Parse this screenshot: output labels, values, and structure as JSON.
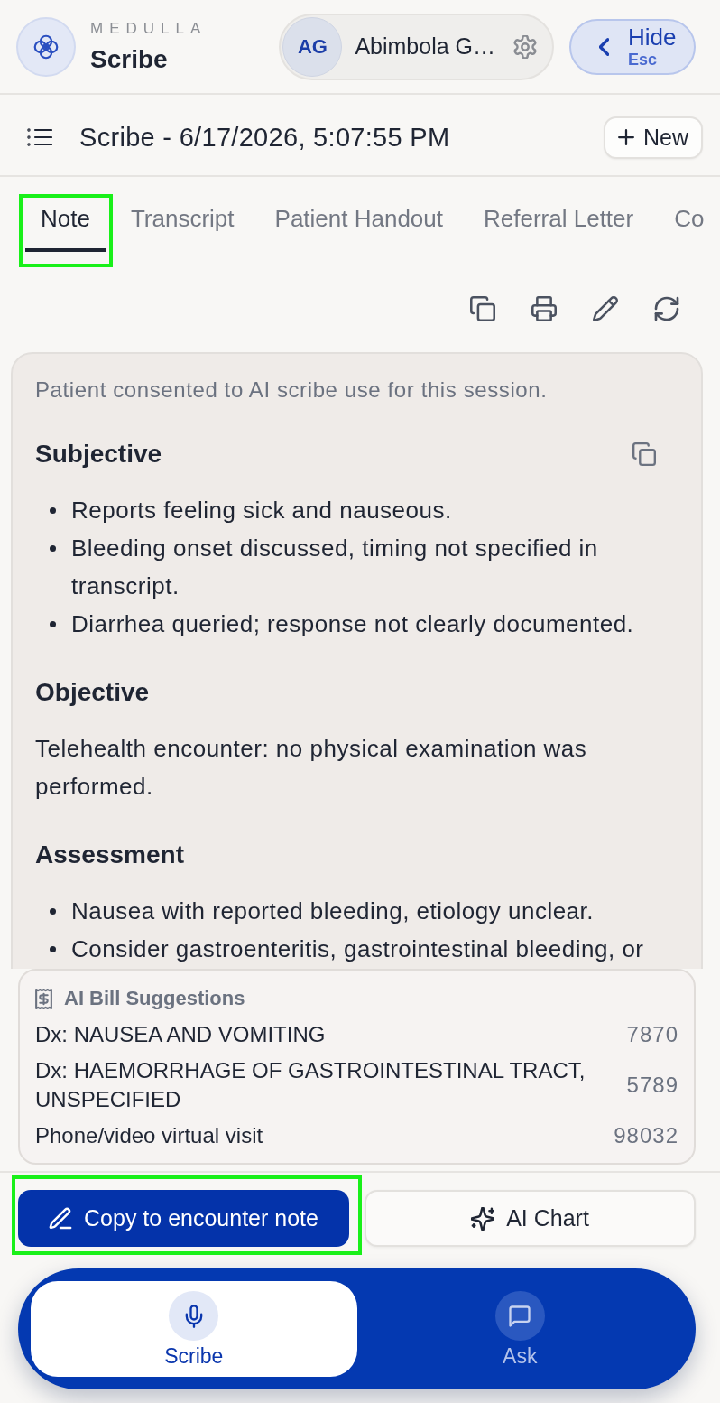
{
  "header": {
    "brand": "MEDULLA",
    "app_name": "Scribe",
    "user": {
      "initials": "AG",
      "name": "Abimbola G…"
    },
    "hide_button": {
      "label": "Hide",
      "shortcut": "Esc"
    }
  },
  "session": {
    "title": "Scribe - 6/17/2026, 5:07:55 PM",
    "new_button": "New"
  },
  "tabs": [
    {
      "label": "Note",
      "selected": true,
      "highlighted": true
    },
    {
      "label": "Transcript",
      "selected": false,
      "highlighted": false
    },
    {
      "label": "Patient Handout",
      "selected": false,
      "highlighted": false
    },
    {
      "label": "Referral Letter",
      "selected": false,
      "highlighted": false
    },
    {
      "label": "Co",
      "selected": false,
      "highlighted": false
    }
  ],
  "note": {
    "consent": "Patient consented to AI scribe use for this session.",
    "sections": [
      {
        "heading": "Subjective",
        "kind": "list",
        "copy_icon": true,
        "items": [
          "Reports feeling sick and nauseous.",
          "Bleeding onset discussed, timing not specified in transcript.",
          "Diarrhea queried; response not clearly documented."
        ]
      },
      {
        "heading": "Objective",
        "kind": "paragraph",
        "copy_icon": false,
        "text": "Telehealth encounter: no physical examination was performed."
      },
      {
        "heading": "Assessment",
        "kind": "list",
        "copy_icon": false,
        "items": [
          "Nausea with reported bleeding, etiology unclear.",
          "Consider gastroenteritis, gastrointestinal bleeding, or"
        ]
      }
    ]
  },
  "bill_suggestions": {
    "title": "AI Bill Suggestions",
    "rows": [
      {
        "description": "Dx: NAUSEA AND VOMITING",
        "code": "7870"
      },
      {
        "description": "Dx: HAEMORRHAGE OF GASTROINTESTINAL TRACT, UNSPECIFIED",
        "code": "5789"
      },
      {
        "description": "Phone/video virtual visit",
        "code": "98032"
      }
    ]
  },
  "actions": [
    {
      "label": "Copy to encounter note",
      "kind": "primary",
      "highlighted": true
    },
    {
      "label": "AI Chart",
      "kind": "secondary",
      "highlighted": false
    }
  ],
  "bottom_nav": [
    {
      "label": "Scribe",
      "selected": true
    },
    {
      "label": "Ask",
      "selected": false
    }
  ]
}
